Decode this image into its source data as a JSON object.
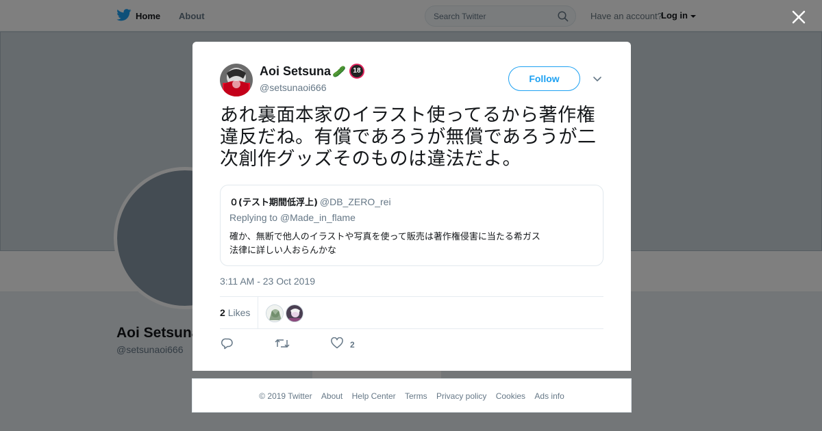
{
  "page": {
    "nav": {
      "home_label": "Home",
      "about_label": "About",
      "search_placeholder": "Search Twitter",
      "have_account": "Have an account?",
      "login_label": "Log in"
    },
    "profile": {
      "name": "Aoi Setsuna",
      "handle": "@setsunaoi666"
    }
  },
  "tweet": {
    "author": {
      "name": "Aoi Setsuna",
      "name_emoji": "🥒",
      "badge": "18",
      "handle": "@setsunaoi666"
    },
    "follow_label": "Follow",
    "text": "あれ裏面本家のイラスト使ってるから著作権違反だね。有償であろうが無償であろうが二次創作グッズそのものは違法だよ。",
    "quoted": {
      "name": "０(テスト期間低浮上)",
      "handle": "@DB_ZERO_rei",
      "replying_prefix": "Replying to",
      "replying_to": "@Made_in_flame",
      "body_line1": "確か、無断で他人のイラストや写真を使って販売は著作権侵害に当たる希ガス",
      "body_line2": "法律に詳しい人おらんかな"
    },
    "timestamp": "3:11 AM - 23 Oct 2019",
    "likes_count": "2",
    "likes_label": "Likes",
    "action_like_count": "2",
    "icons": [
      "reply-icon",
      "retweet-icon",
      "heart-icon",
      "chevron-down-icon",
      "close-icon",
      "twitter-bird-icon",
      "search-icon"
    ]
  },
  "footer": {
    "copyright": "© 2019 Twitter",
    "links": [
      "About",
      "Help Center",
      "Terms",
      "Privacy policy",
      "Cookies",
      "Ads info"
    ]
  },
  "colors": {
    "accent": "#1da1f2",
    "text": "#14171a",
    "muted": "#657786"
  }
}
